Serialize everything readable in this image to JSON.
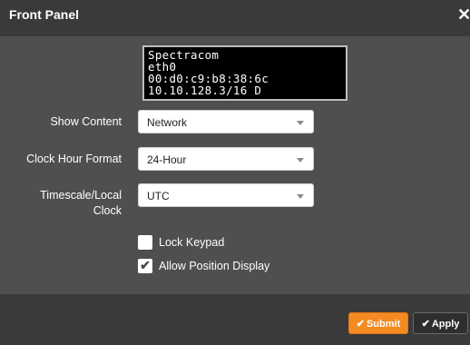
{
  "dialog": {
    "title": "Front Panel",
    "close_glyph": "✕",
    "close_icon": "close-icon"
  },
  "lcd": {
    "lines": [
      "Spectracom",
      "eth0",
      "00:d0:c9:b8:38:6c",
      "10.10.128.3/16 D"
    ]
  },
  "form": {
    "show_content": {
      "label": "Show Content",
      "value": "Network"
    },
    "clock_hour_format": {
      "label": "Clock Hour Format",
      "value": "24-Hour"
    },
    "timescale": {
      "label_line1": "Timescale/Local",
      "label_line2": "Clock",
      "value": "UTC"
    },
    "lock_keypad": {
      "label": "Lock Keypad",
      "checked": false
    },
    "allow_position_display": {
      "label": "Allow Position Display",
      "checked": true
    }
  },
  "footer": {
    "submit_label": "Submit",
    "apply_label": "Apply",
    "check_glyph": "✔"
  },
  "colors": {
    "accent_orange": "#f48a22",
    "panel_bg": "#4f4f4f",
    "bar_bg": "#3a3a3a"
  }
}
